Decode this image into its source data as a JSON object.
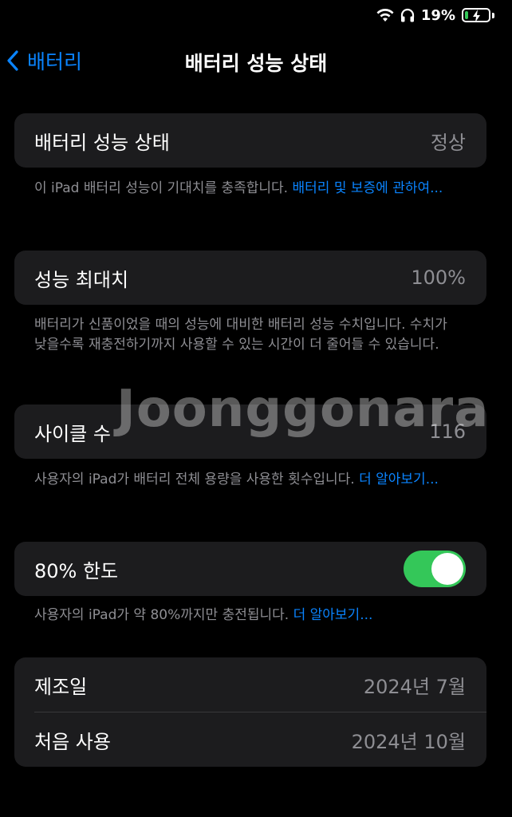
{
  "status_bar": {
    "battery_percent": "19%",
    "icons": [
      "wifi-icon",
      "headphones-icon",
      "battery-charging-icon"
    ]
  },
  "nav": {
    "back_label": "배터리",
    "title": "배터리 성능 상태"
  },
  "health": {
    "label": "배터리 성능 상태",
    "value": "정상"
  },
  "health_note": {
    "text": "이 iPad 배터리 성능이 기대치를 충족합니다. ",
    "link": "배터리 및 보증에 관하여..."
  },
  "max_capacity": {
    "label": "성능 최대치",
    "value": "100%"
  },
  "capacity_note": {
    "text": "배터리가 신품이었을 때의 성능에 대비한 배터리 성능 수치입니다. 수치가 낮을수록 재충전하기까지 사용할 수 있는 시간이 더 줄어들 수 있습니다."
  },
  "cycle_count": {
    "label": "사이클 수",
    "value": "116"
  },
  "cycle_note": {
    "text": "사용자의 iPad가 배터리 전체 용량을 사용한 횟수입니다. ",
    "link": "더 알아보기..."
  },
  "limit_80": {
    "label": "80% 한도",
    "enabled": true
  },
  "limit_note": {
    "text": "사용자의 iPad가 약 80%까지만 충전됩니다. ",
    "link": "더 알아보기..."
  },
  "dates": [
    {
      "label": "제조일",
      "value": "2024년 7월"
    },
    {
      "label": "처음 사용",
      "value": "2024년 10월"
    }
  ],
  "watermark": "Joonggonara",
  "colors": {
    "accent": "#0a84ff",
    "toggle_on": "#34c759",
    "card": "#1c1c1e",
    "secondary_text": "#8e8e93"
  }
}
